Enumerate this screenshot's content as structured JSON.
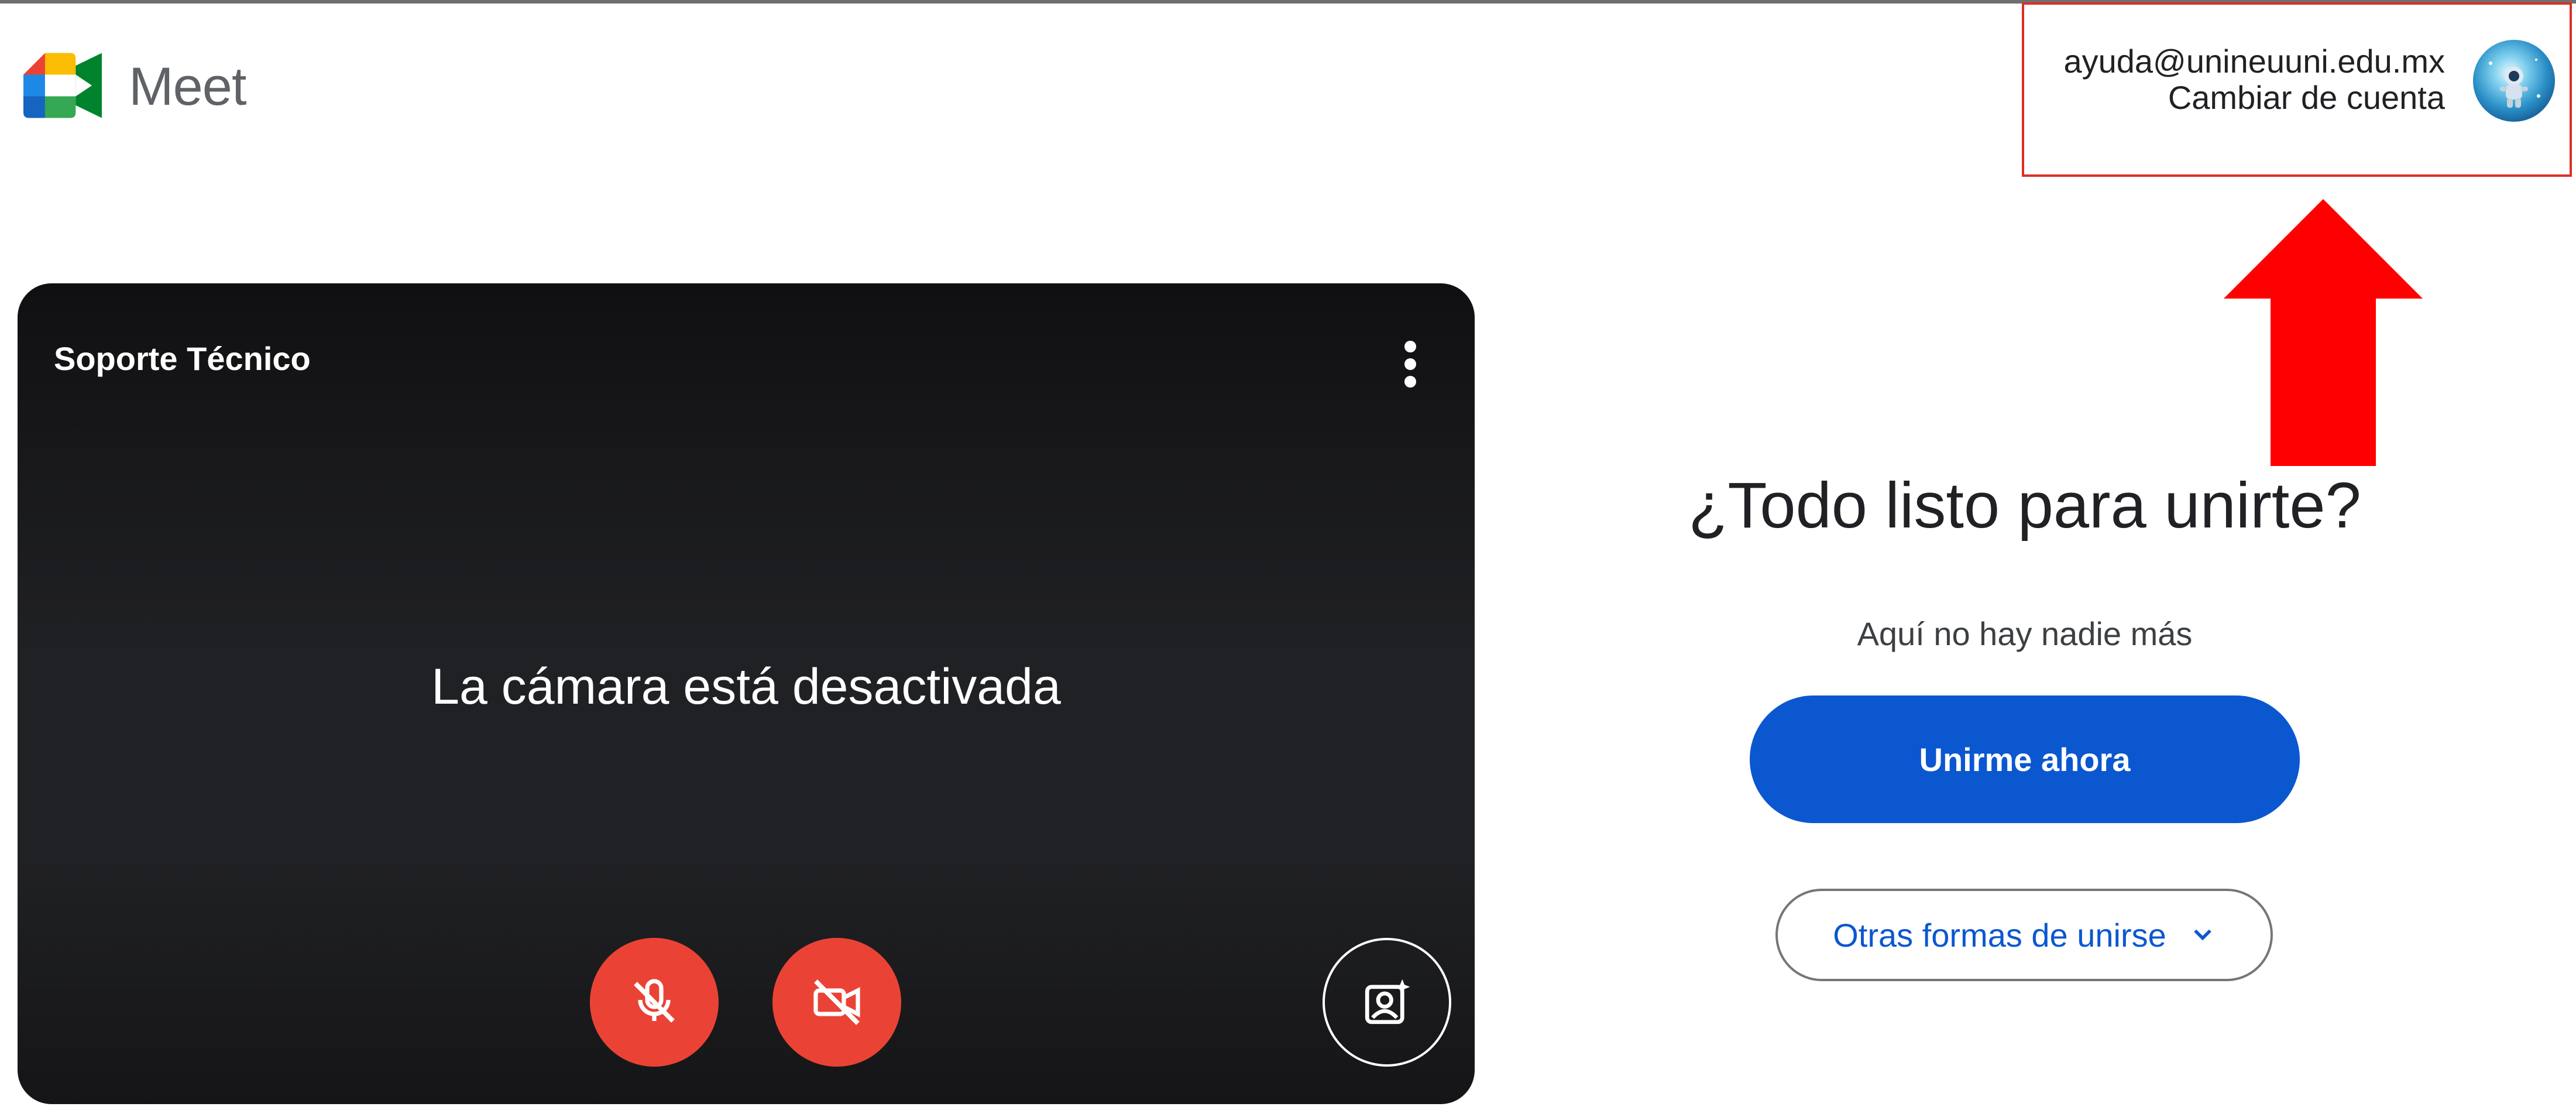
{
  "header": {
    "app_name": "Meet",
    "account": {
      "email": "ayuda@unineuuni.edu.mx",
      "switch_label": "Cambiar de cuenta",
      "highlight_color": "#d93025"
    }
  },
  "annotation": {
    "arrow_color": "#ff0000",
    "points_to": "account-box"
  },
  "preview": {
    "participant_name": "Soporte Técnico",
    "camera_status": "La cámara está desactivada",
    "controls": [
      {
        "name": "microphone-off",
        "icon": "mic-off-icon",
        "state": "off",
        "color": "#ea4335"
      },
      {
        "name": "camera-off",
        "icon": "videocam-off-icon",
        "state": "off",
        "color": "#ea4335"
      },
      {
        "name": "visual-effects",
        "icon": "portrait-sparkle-icon"
      }
    ],
    "more_icon": "more-vert-icon"
  },
  "join": {
    "title": "¿Todo listo para unirte?",
    "status": "Aquí no hay nadie más",
    "join_button": "Unirme ahora",
    "other_ways_button": "Otras formas de unirse",
    "accent_color": "#0b57d0"
  }
}
